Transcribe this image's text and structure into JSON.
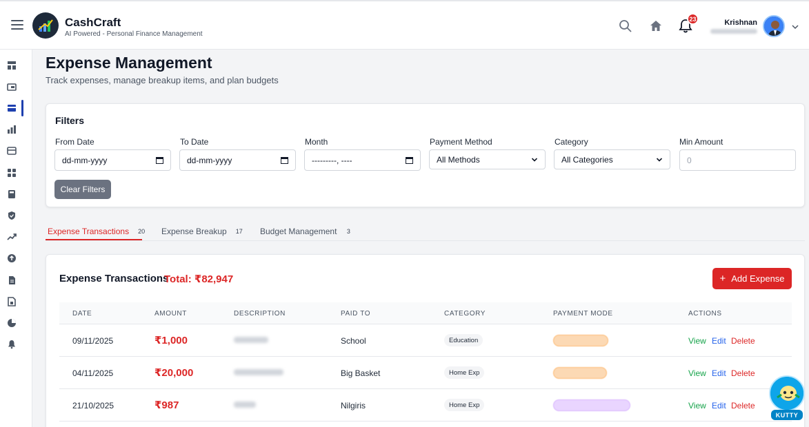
{
  "app": {
    "title": "CashCraft",
    "subtitle": "AI Powered - Personal Finance Management"
  },
  "header": {
    "notification_count": "23",
    "user_name": "Krishnan"
  },
  "page": {
    "title": "Expense Management",
    "subtitle": "Track expenses, manage breakup items, and plan budgets"
  },
  "filters": {
    "title": "Filters",
    "from_date": {
      "label": "From Date",
      "value": "dd-mm-yyyy"
    },
    "to_date": {
      "label": "To Date",
      "value": "dd-mm-yyyy"
    },
    "month": {
      "label": "Month",
      "value": "---------, ----"
    },
    "payment_method": {
      "label": "Payment Method",
      "value": "All Methods"
    },
    "category": {
      "label": "Category",
      "value": "All Categories"
    },
    "min_amount": {
      "label": "Min Amount",
      "placeholder": "0"
    },
    "clear_label": "Clear Filters"
  },
  "tabs": [
    {
      "label": "Expense Transactions",
      "count": "20",
      "active": true
    },
    {
      "label": "Expense Breakup",
      "count": "17",
      "active": false
    },
    {
      "label": "Budget Management",
      "count": "3",
      "active": false
    }
  ],
  "table": {
    "title": "Expense Transactions",
    "total": "Total: ₹82,947",
    "add_label": "Add Expense",
    "columns": [
      "DATE",
      "AMOUNT",
      "DESCRIPTION",
      "PAID TO",
      "CATEGORY",
      "PAYMENT MODE",
      "ACTIONS"
    ],
    "rows": [
      {
        "date": "09/11/2025",
        "amount": "₹1,000",
        "paid_to": "School",
        "category": "Education"
      },
      {
        "date": "04/11/2025",
        "amount": "₹20,000",
        "paid_to": "Big Basket",
        "category": "Home Exp"
      },
      {
        "date": "21/10/2025",
        "amount": "₹987",
        "paid_to": "Nilgiris",
        "category": "Home Exp"
      }
    ],
    "actions": {
      "view": "View",
      "edit": "Edit",
      "delete": "Delete"
    }
  },
  "assistant": {
    "label": "KUTTY"
  },
  "colors": {
    "accent_red": "#dc2626",
    "view_green": "#16a34a",
    "edit_blue": "#2563eb",
    "pill_orange": "#fcd9b4",
    "pill_purple": "#e9d5ff"
  }
}
